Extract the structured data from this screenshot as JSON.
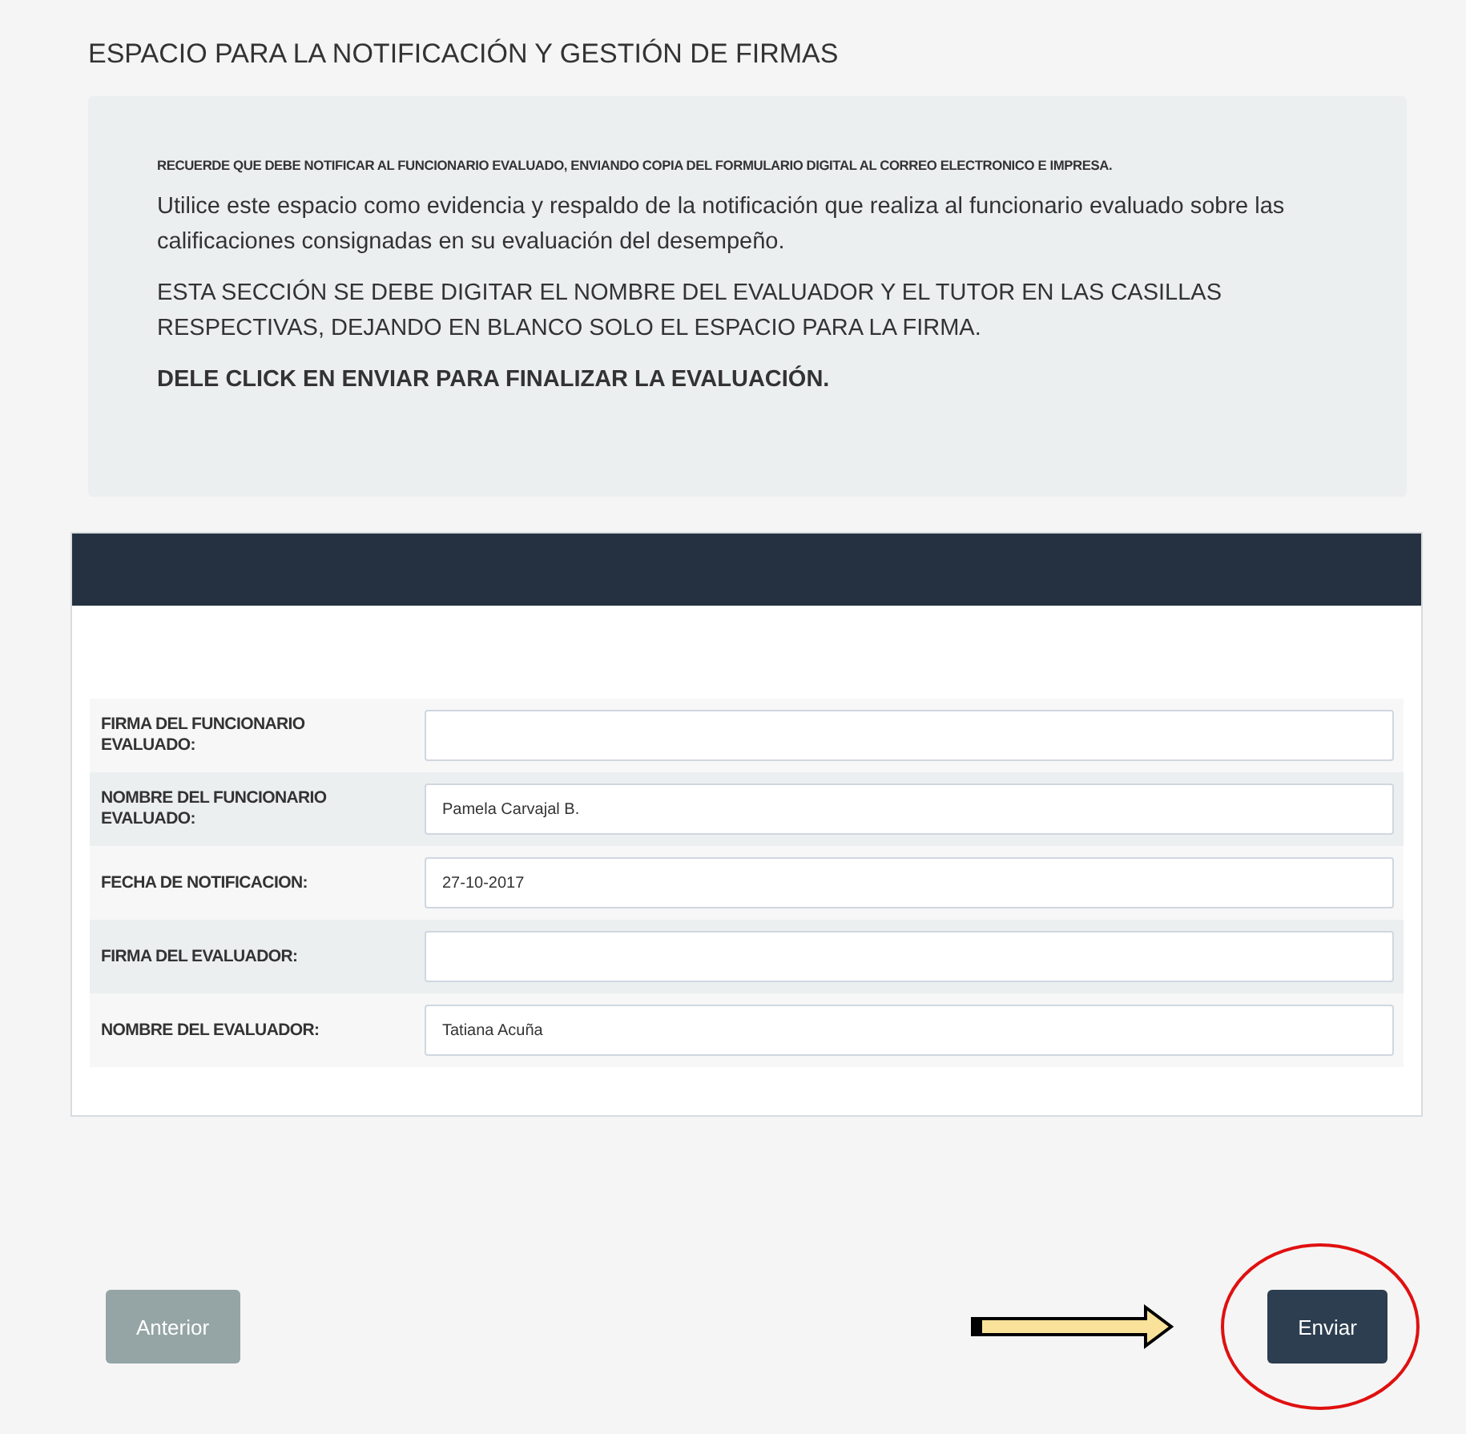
{
  "title": "ESPACIO PARA LA NOTIFICACIÓN Y GESTIÓN DE FIRMAS",
  "notice": {
    "reminder": "RECUERDE QUE DEBE NOTIFICAR AL FUNCIONARIO EVALUADO, ENVIANDO COPIA DEL FORMULARIO DIGITAL AL CORREO ELECTRONICO E IMPRESA.",
    "paragraphs": [
      {
        "text": "Utilice este espacio como evidencia y respaldo de la notificación que realiza al funcionario evaluado sobre las calificaciones consignadas en su evaluación del desempeño.",
        "bold": false
      },
      {
        "text": "ESTA SECCIÓN SE DEBE DIGITAR EL NOMBRE DEL EVALUADOR Y EL TUTOR EN LAS CASILLAS RESPECTIVAS, DEJANDO EN BLANCO SOLO EL ESPACIO PARA LA FIRMA.",
        "bold": false
      },
      {
        "text": "DELE CLICK EN ENVIAR PARA FINALIZAR LA EVALUACIÓN.",
        "bold": true
      }
    ]
  },
  "form": {
    "fields": [
      {
        "label": "FIRMA DEL FUNCIONARIO EVALUADO:"
      },
      {
        "label": "NOMBRE DEL FUNCIONARIO EVALUADO:",
        "value": "Pamela Carvajal B."
      },
      {
        "label": "FECHA DE NOTIFICACION:",
        "value": "27-10-2017"
      },
      {
        "label": "FIRMA DEL EVALUADOR:"
      },
      {
        "label": "NOMBRE DEL EVALUADOR:",
        "value": "Tatiana Acuña"
      }
    ]
  },
  "buttons": [
    {
      "label": "Anterior",
      "disabled": true
    },
    {
      "label": "Enviar",
      "disabled": false,
      "highlighted": true
    }
  ]
}
